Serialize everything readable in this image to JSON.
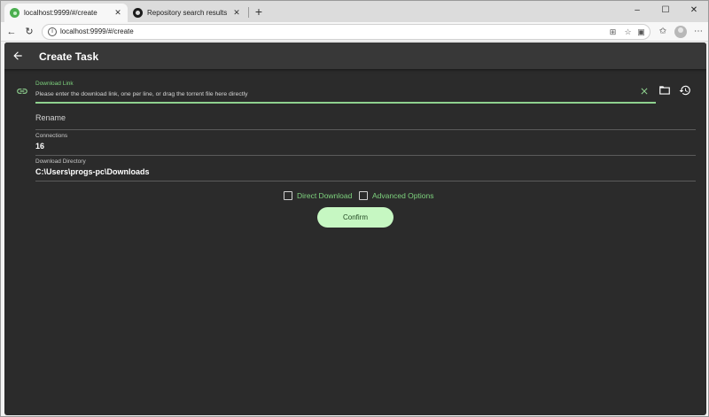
{
  "browser": {
    "tabs": [
      {
        "title": "localhost:9999/#/create",
        "active": true,
        "favicon": "app-logo-icon"
      },
      {
        "title": "Repository search results · GitHub",
        "active": false,
        "favicon": "github-icon"
      }
    ],
    "url": "localhost:9999/#/create",
    "window_controls": {
      "minimize": "–",
      "maximize": "☐",
      "close": "✕"
    }
  },
  "app": {
    "title": "Create Task",
    "accent_color": "#8fd18f",
    "background_color": "#2b2b2b"
  },
  "form": {
    "download_link": {
      "label": "Download Link",
      "placeholder": "Please enter the download link, one per line, or drag the torrent file here directly",
      "value": ""
    },
    "rename": {
      "placeholder": "Rename",
      "value": ""
    },
    "connections": {
      "label": "Connections",
      "value": "16"
    },
    "download_directory": {
      "label": "Download Directory",
      "value": "C:\\Users\\progs-pc\\Downloads"
    },
    "options": {
      "direct_download": {
        "label": "Direct Download",
        "checked": false
      },
      "advanced_options": {
        "label": "Advanced Options",
        "checked": false
      }
    },
    "confirm_label": "Confirm"
  }
}
